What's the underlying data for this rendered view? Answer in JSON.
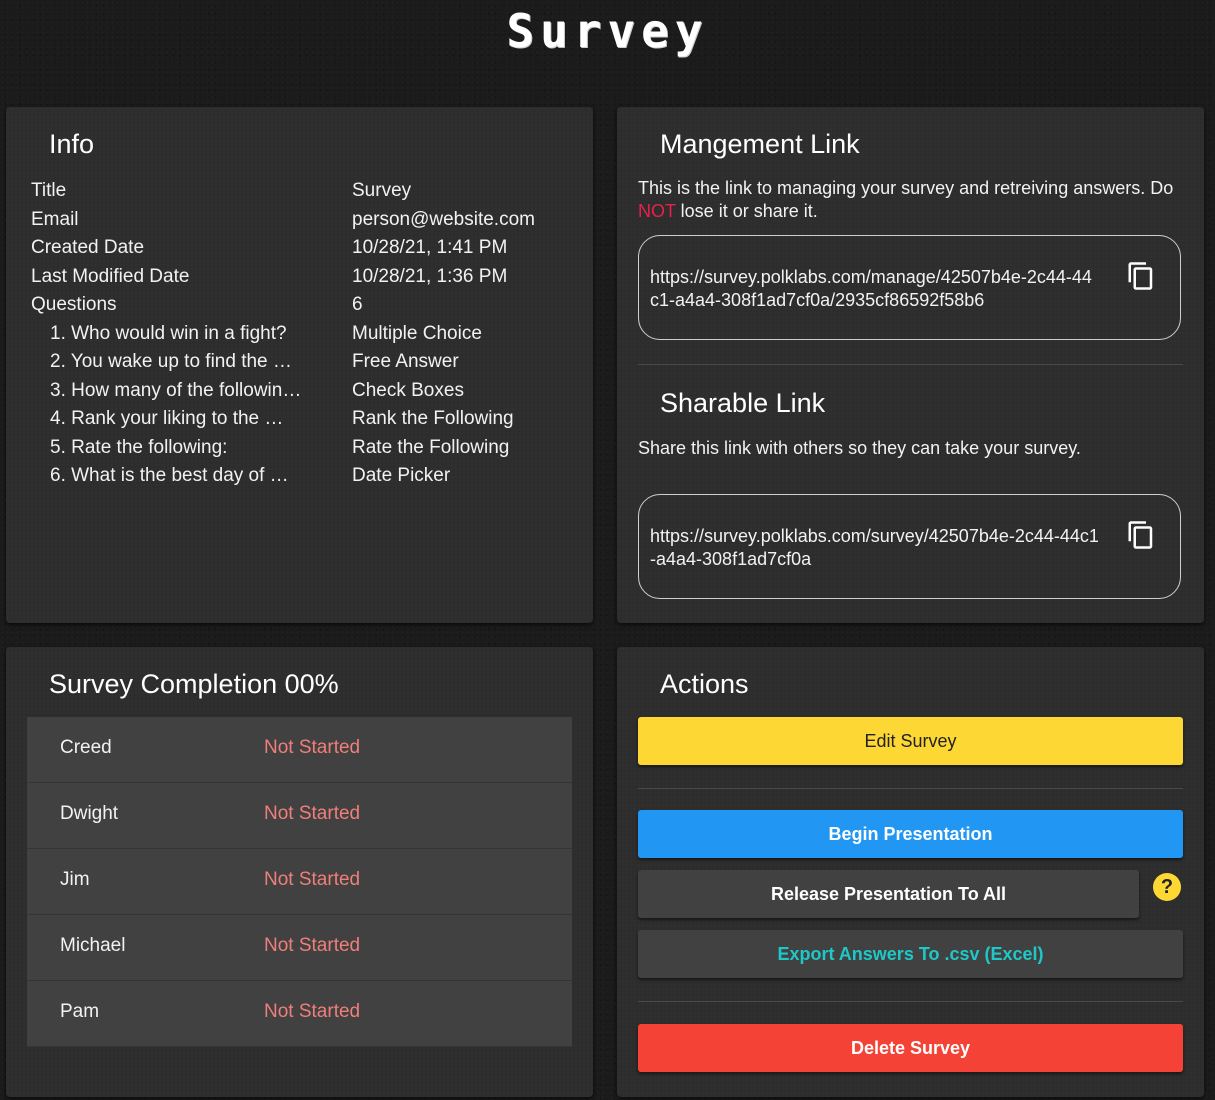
{
  "app": {
    "title": "Survey"
  },
  "info": {
    "heading": "Info",
    "rows": [
      {
        "key": "Title",
        "value": "Survey"
      },
      {
        "key": "Email",
        "value": "person@website.com"
      },
      {
        "key": "Created Date",
        "value": "10/28/21, 1:41 PM"
      },
      {
        "key": "Last Modified Date",
        "value": "10/28/21, 1:36 PM"
      },
      {
        "key": "Questions",
        "value": "6"
      }
    ],
    "questions": [
      {
        "label": "1. Who would win in a fight?",
        "type": "Multiple Choice"
      },
      {
        "label": "2. You wake up to find the …",
        "type": "Free Answer"
      },
      {
        "label": "3. How many of the followin…",
        "type": "Check Boxes"
      },
      {
        "label": "4. Rank your liking to the …",
        "type": "Rank the Following"
      },
      {
        "label": "5. Rate the following:",
        "type": "Rate the Following"
      },
      {
        "label": "6. What is the best day of …",
        "type": "Date Picker"
      }
    ]
  },
  "management": {
    "heading": "Mangement Link",
    "desc_pre": "This is the link to managing your survey and retreiving answers. Do ",
    "desc_not": "NOT",
    "desc_post": " lose it or share it.",
    "url": "https://survey.polklabs.com/manage/42507b4e-2c44-44c1-a4a4-308f1ad7cf0a/2935cf86592f58b6"
  },
  "sharable": {
    "heading": "Sharable Link",
    "desc": "Share this link with others so they can take your survey.",
    "url": "https://survey.polklabs.com/survey/42507b4e-2c44-44c1-a4a4-308f1ad7cf0a"
  },
  "completion": {
    "heading": "Survey Completion 00%",
    "participants": [
      {
        "name": "Creed",
        "status": "Not Started"
      },
      {
        "name": "Dwight",
        "status": "Not Started"
      },
      {
        "name": "Jim",
        "status": "Not Started"
      },
      {
        "name": "Michael",
        "status": "Not Started"
      },
      {
        "name": "Pam",
        "status": "Not Started"
      }
    ]
  },
  "actions": {
    "heading": "Actions",
    "edit": "Edit Survey",
    "begin": "Begin Presentation",
    "release": "Release Presentation To All",
    "help": "?",
    "export": "Export Answers To .csv (Excel)",
    "delete": "Delete Survey"
  },
  "colors": {
    "accent_yellow": "#fdd835",
    "accent_blue": "#2196f3",
    "accent_red": "#f44336",
    "export_teal": "#1ec8c8",
    "status_red": "#ef7f7a",
    "warning_red": "#e8204a"
  },
  "icons": {
    "copy": "copy-icon",
    "help": "help-icon"
  }
}
